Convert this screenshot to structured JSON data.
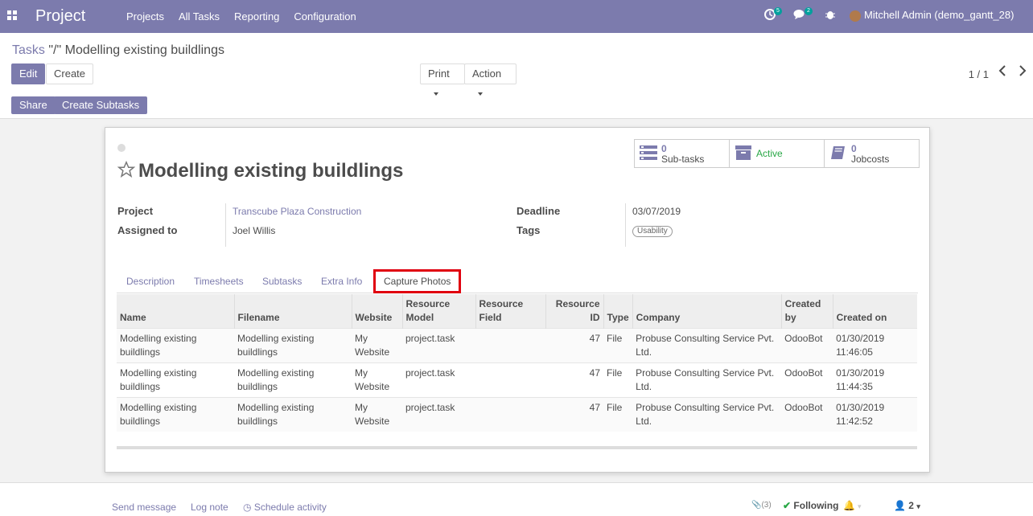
{
  "navbar": {
    "app_name": "Project",
    "menu": [
      "Projects",
      "All Tasks",
      "Reporting",
      "Configuration"
    ],
    "activity_count": "5",
    "message_count": "2",
    "user": "Mitchell Admin (demo_gantt_28)"
  },
  "breadcrumb": {
    "parent": "Tasks",
    "separator": "\"/\"",
    "current": "Modelling existing buildlings"
  },
  "buttons": {
    "edit": "Edit",
    "create": "Create",
    "print": "Print",
    "action": "Action",
    "share": "Share",
    "create_subtasks": "Create Subtasks"
  },
  "pager": {
    "value": "1 / 1",
    "prev_icon": "chevron-left-icon",
    "next_icon": "chevron-right-icon"
  },
  "record": {
    "title": "Modelling existing buildlings",
    "smart_buttons": {
      "subtasks": {
        "value": "0",
        "label": "Sub-tasks"
      },
      "active": {
        "label": "Active"
      },
      "jobcosts": {
        "value": "0",
        "label": "Jobcosts"
      }
    },
    "fields": {
      "project_label": "Project",
      "project_value": "Transcube Plaza Construction",
      "assigned_label": "Assigned to",
      "assigned_value": "Joel Willis",
      "deadline_label": "Deadline",
      "deadline_value": "03/07/2019",
      "tags_label": "Tags",
      "tags_value": "Usability"
    }
  },
  "tabs": [
    "Description",
    "Timesheets",
    "Subtasks",
    "Extra Info",
    "Capture Photos"
  ],
  "table": {
    "headers": [
      "Name",
      "Filename",
      "Website",
      "Resource Model",
      "Resource Field",
      "Resource ID",
      "Type",
      "Company",
      "Created by",
      "Created on"
    ],
    "rows": [
      [
        "Modelling existing buildlings",
        "Modelling existing buildlings",
        "My Website",
        "project.task",
        "",
        "47",
        "File",
        "Probuse Consulting Service Pvt. Ltd.",
        "OdooBot",
        "01/30/2019 11:46:05"
      ],
      [
        "Modelling existing buildlings",
        "Modelling existing buildlings",
        "My Website",
        "project.task",
        "",
        "47",
        "File",
        "Probuse Consulting Service Pvt. Ltd.",
        "OdooBot",
        "01/30/2019 11:44:35"
      ],
      [
        "Modelling existing buildlings",
        "Modelling existing buildlings",
        "My Website",
        "project.task",
        "",
        "47",
        "File",
        "Probuse Consulting Service Pvt. Ltd.",
        "OdooBot",
        "01/30/2019 11:42:52"
      ]
    ]
  },
  "chatter": {
    "send_message": "Send message",
    "log_note": "Log note",
    "schedule_activity": "Schedule activity",
    "attachments": "(3)",
    "following": "Following",
    "followers": "2"
  },
  "colors": {
    "brand": "#7c7bad",
    "highlight": "#e0000f",
    "active": "#28a745"
  }
}
